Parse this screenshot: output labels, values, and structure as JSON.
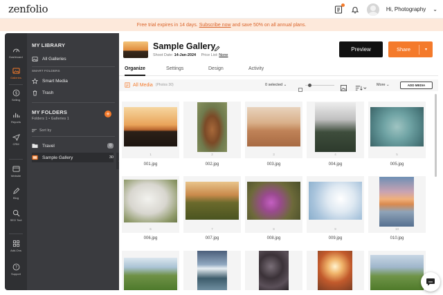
{
  "app": {
    "logo": "zenfolio"
  },
  "header": {
    "user_name": "Hi, Photography",
    "user_caret": "⌄"
  },
  "promo": {
    "pre": "Free trial expires in 14 days.",
    "link": "Subscribe now",
    "post": "and save 50% on all annual plans."
  },
  "rail": {
    "items": [
      {
        "label": "Dashboard",
        "icon": "dashboard-icon"
      },
      {
        "label": "Galleries",
        "icon": "galleries-icon"
      },
      {
        "label": "Selling",
        "icon": "dollar-icon"
      },
      {
        "label": "Reports",
        "icon": "chart-icon"
      },
      {
        "label": "CRM",
        "icon": "send-icon"
      },
      {
        "label": "Website",
        "icon": "website-icon"
      },
      {
        "label": "Blog",
        "icon": "blog-icon"
      },
      {
        "label": "SEO Tool",
        "icon": "search-icon"
      },
      {
        "label": "Add-Ons",
        "icon": "grid-icon"
      },
      {
        "label": "Support",
        "icon": "help-icon"
      }
    ]
  },
  "library": {
    "title": "MY LIBRARY",
    "all_galleries": "All Galleries",
    "smart_folders_label": "SMART FOLDERS",
    "smart_media": "Smart Media",
    "trash": "Trash",
    "my_folders": "MY FOLDERS",
    "folders_summary": "Folders 1 • Galleries 1",
    "sort_by": "Sort by",
    "folders": [
      {
        "name": "Travel",
        "count": "0"
      },
      {
        "name": "Sample Gallery",
        "count": "30"
      }
    ]
  },
  "gallery": {
    "title": "Sample Gallery",
    "shoot_date_label": "Shoot Date:",
    "shoot_date": "14-Jan-2024",
    "price_list_label": "Price List:",
    "price_list": "None",
    "preview_label": "Preview",
    "share_label": "Share"
  },
  "tabs": [
    "Organize",
    "Settings",
    "Design",
    "Activity"
  ],
  "toolbar": {
    "all_media": "All Media",
    "photo_count": "(Photos 30)",
    "selected": "0 selected",
    "more": "More",
    "add_media": "ADD MEDIA"
  },
  "photos": [
    {
      "num": "1",
      "name": "001.jpg"
    },
    {
      "num": "2",
      "name": "002.jpg"
    },
    {
      "num": "3",
      "name": "003.jpg"
    },
    {
      "num": "4",
      "name": "004.jpg"
    },
    {
      "num": "5",
      "name": "005.jpg"
    },
    {
      "num": "6",
      "name": "006.jpg"
    },
    {
      "num": "7",
      "name": "007.jpg"
    },
    {
      "num": "8",
      "name": "008.jpg"
    },
    {
      "num": "9",
      "name": "009.jpg"
    },
    {
      "num": "10",
      "name": "010.jpg"
    }
  ],
  "colors": {
    "accent": "#f47a2b",
    "dark": "#111111",
    "panel": "#3a3b3f",
    "rail": "#2f3033"
  }
}
